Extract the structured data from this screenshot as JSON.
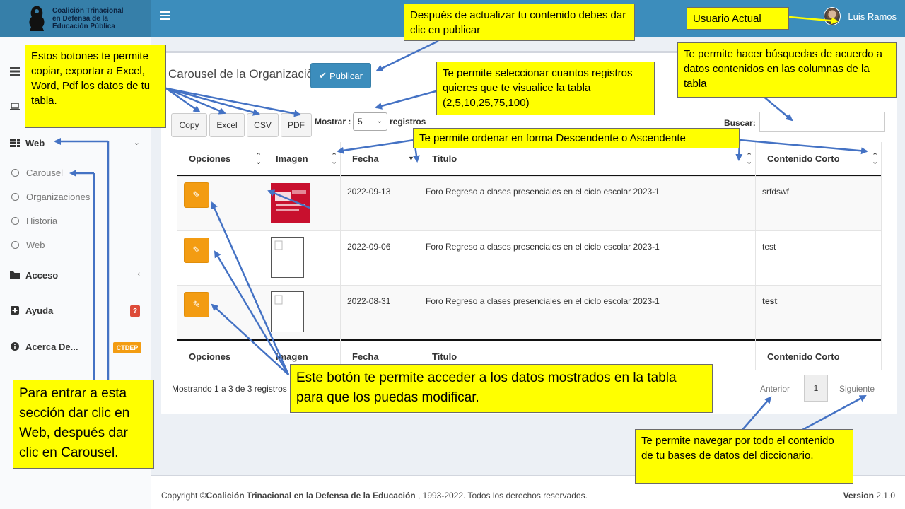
{
  "header": {
    "org_name_line1": "Coalición Trinacional",
    "org_name_line2": "en Defensa de la",
    "org_name_line3": "Educación Pública",
    "user_name": "Luis Ramos"
  },
  "sidebar": {
    "web": "Web",
    "sub_items": [
      "Carousel",
      "Organizaciones",
      "Historia",
      "Web"
    ],
    "acceso": "Acceso",
    "ayuda": "Ayuda",
    "ayuda_badge": "?",
    "acerca": "Acerca De...",
    "acerca_badge": "CTDEP"
  },
  "main": {
    "title": "Carousel de la Organizaciòn",
    "publish_label": "Publicar",
    "export_buttons": [
      "Copy",
      "Excel",
      "CSV",
      "PDF"
    ],
    "show_label": "Mostrar :",
    "show_value": "5",
    "show_suffix": "registros",
    "search_label": "Buscar:",
    "columns": [
      "Opciones",
      "Imagen",
      "Fecha",
      "Titulo",
      "Contenido Corto"
    ],
    "rows": [
      {
        "fecha": "2022-09-13",
        "titulo": "Foro Regreso a clases presenciales en el ciclo escolar 2023-1",
        "contenido": "srfdswf"
      },
      {
        "fecha": "2022-09-06",
        "titulo": "Foro Regreso a clases presenciales en el ciclo escolar 2023-1",
        "contenido": "test"
      },
      {
        "fecha": "2022-08-31",
        "titulo": "Foro Regreso a clases presenciales en el ciclo escolar 2023-1",
        "contenido": "test"
      }
    ],
    "info": "Mostrando 1 a 3 de 3 registros",
    "prev": "Anterior",
    "page": "1",
    "next": "Siguiente"
  },
  "footer": {
    "copyright_prefix": "Copyright ©",
    "org": "Coalición Trinacional en la Defensa de la Educación",
    "copyright_suffix": " , 1993-2022. Todos los derechos reservados.",
    "version_label": "Version",
    "version": "2.1.0"
  },
  "callouts": {
    "publish": "Después de actualizar tu contenido debes dar clic en publicar",
    "user": "Usuario Actual",
    "export": "Estos botones te permite copiar, exportar a Excel, Word, Pdf los datos de tu tabla.",
    "records": "Te permite seleccionar cuantos registros quieres que te visualice la tabla (2,5,10,25,75,100)",
    "search": "Te permite hacer búsquedas de acuerdo a datos contenidos en las columnas de la tabla",
    "sort": "Te permite ordenar en forma Descendente o Ascendente",
    "edit": "Este botón te permite acceder a los datos mostrados en la tabla para que los puedas modificar.",
    "nav": "Para entrar a esta sección dar clic en Web, después dar clic en Carousel.",
    "pagination": "Te permite navegar por todo el contenido de tu bases de datos del diccionario."
  },
  "colors": {
    "header": "#3c8dbc",
    "callout": "#ffff00",
    "edit": "#f39c12",
    "arrow": "#4472c4"
  }
}
